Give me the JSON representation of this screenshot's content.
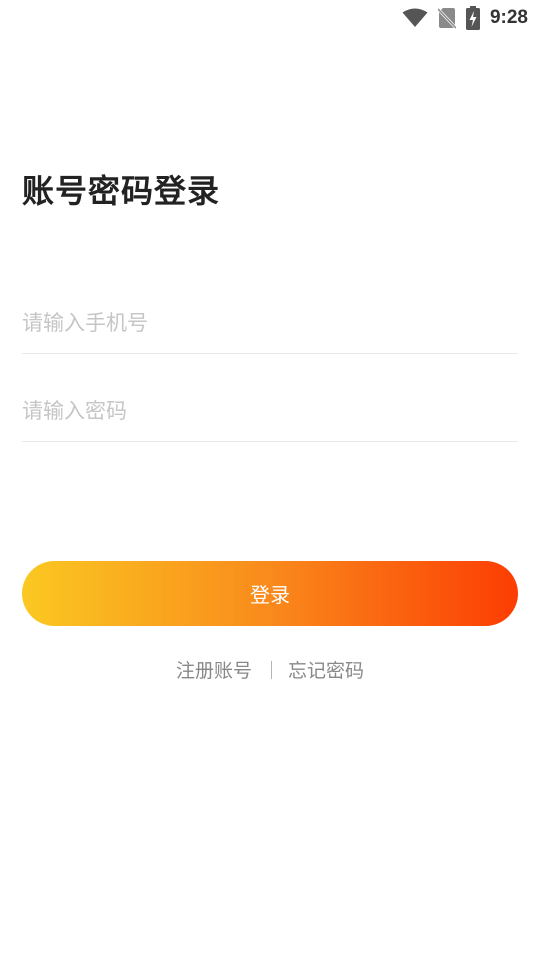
{
  "status_bar": {
    "time": "9:28",
    "icons": [
      "wifi-icon",
      "no-sim-icon",
      "battery-charging-icon"
    ]
  },
  "login": {
    "title": "账号密码登录",
    "phone_placeholder": "请输入手机号",
    "password_placeholder": "请输入密码",
    "submit_label": "登录",
    "register_label": "注册账号",
    "forgot_label": "忘记密码"
  },
  "colors": {
    "gradient_start": "#fbc821",
    "gradient_end": "#fc3d03",
    "placeholder": "#c6c6c6",
    "link_text": "#888888"
  }
}
